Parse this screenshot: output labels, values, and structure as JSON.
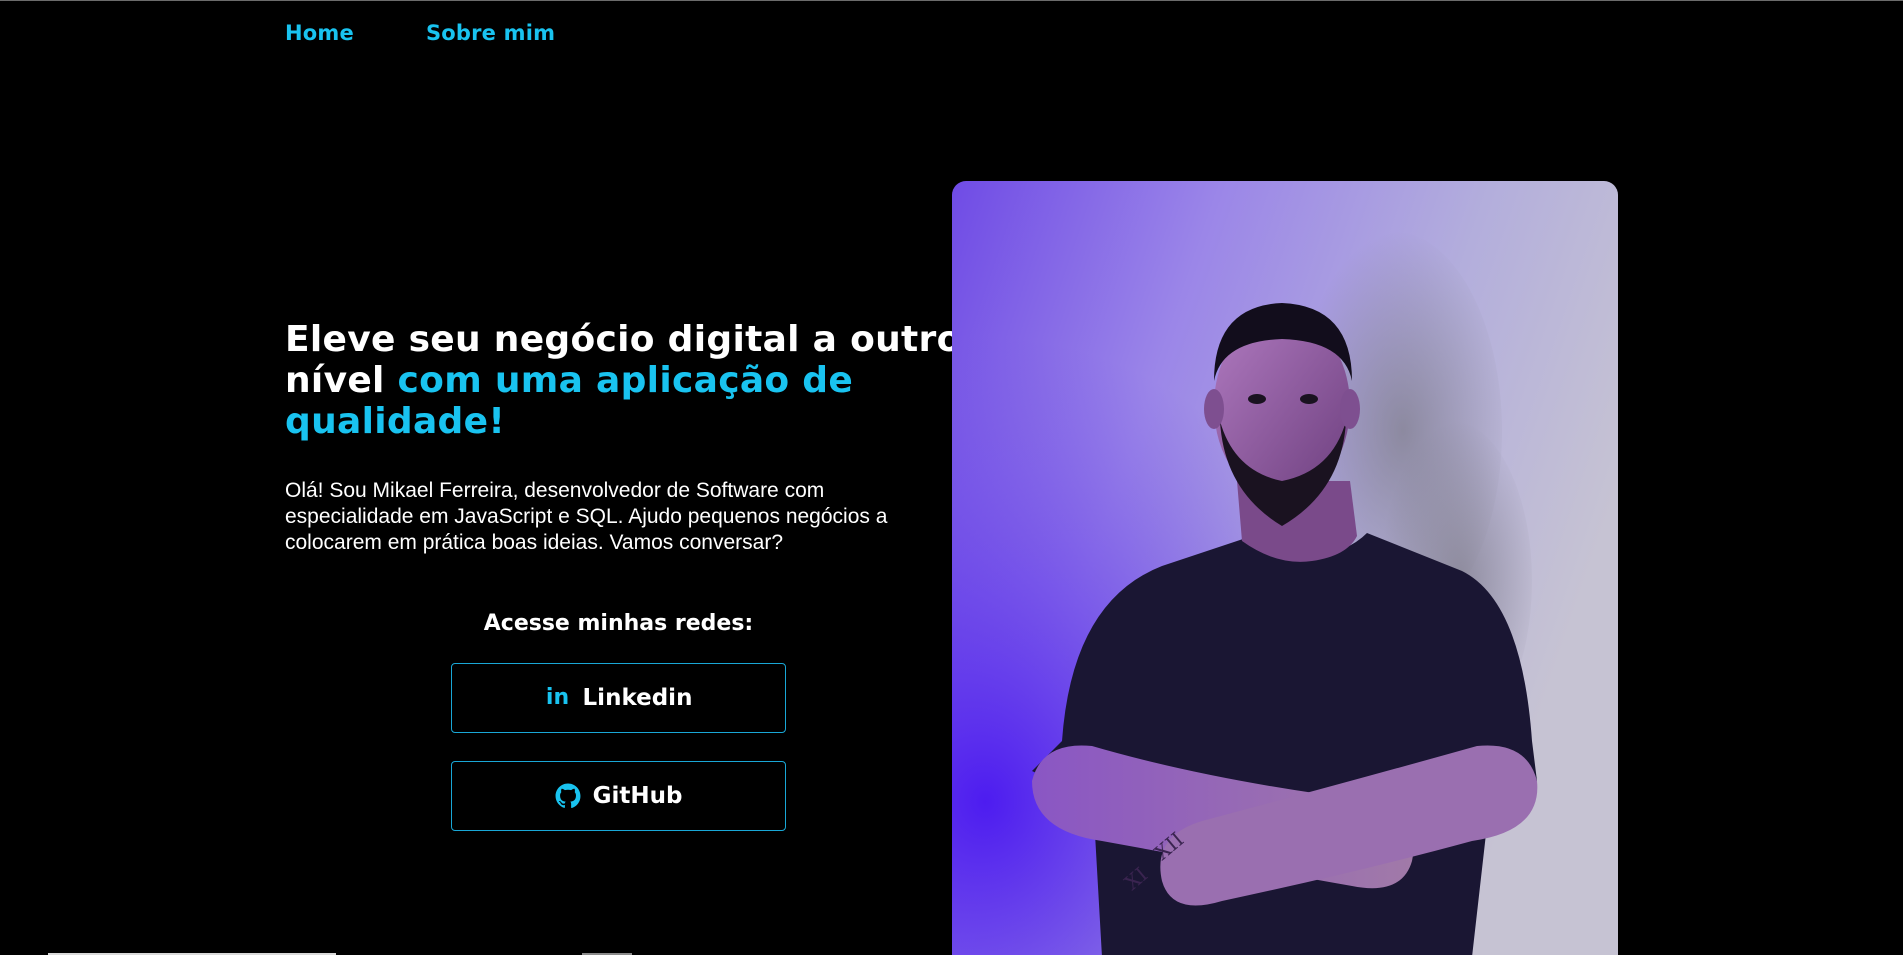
{
  "nav": {
    "items": [
      {
        "label": "Home"
      },
      {
        "label": "Sobre mim"
      }
    ]
  },
  "hero": {
    "headline_part1": "Eleve seu negócio digital a outro nível ",
    "headline_accent": "com uma aplicação de qualidade!",
    "intro": "Olá! Sou Mikael Ferreira, desenvolvedor de Software com especialidade em JavaScript e SQL. Ajudo pequenos negócios a colocarem em prática boas ideias. Vamos conversar?"
  },
  "social": {
    "title": "Acesse minhas redes:",
    "linkedin_label": "Linkedin",
    "linkedin_icon": "linkedin-icon",
    "github_label": "GitHub",
    "github_icon": "github-icon"
  },
  "colors": {
    "background": "#000000",
    "accent": "#19c3f0",
    "text": "#ffffff",
    "button_border": "#19a7d6"
  }
}
